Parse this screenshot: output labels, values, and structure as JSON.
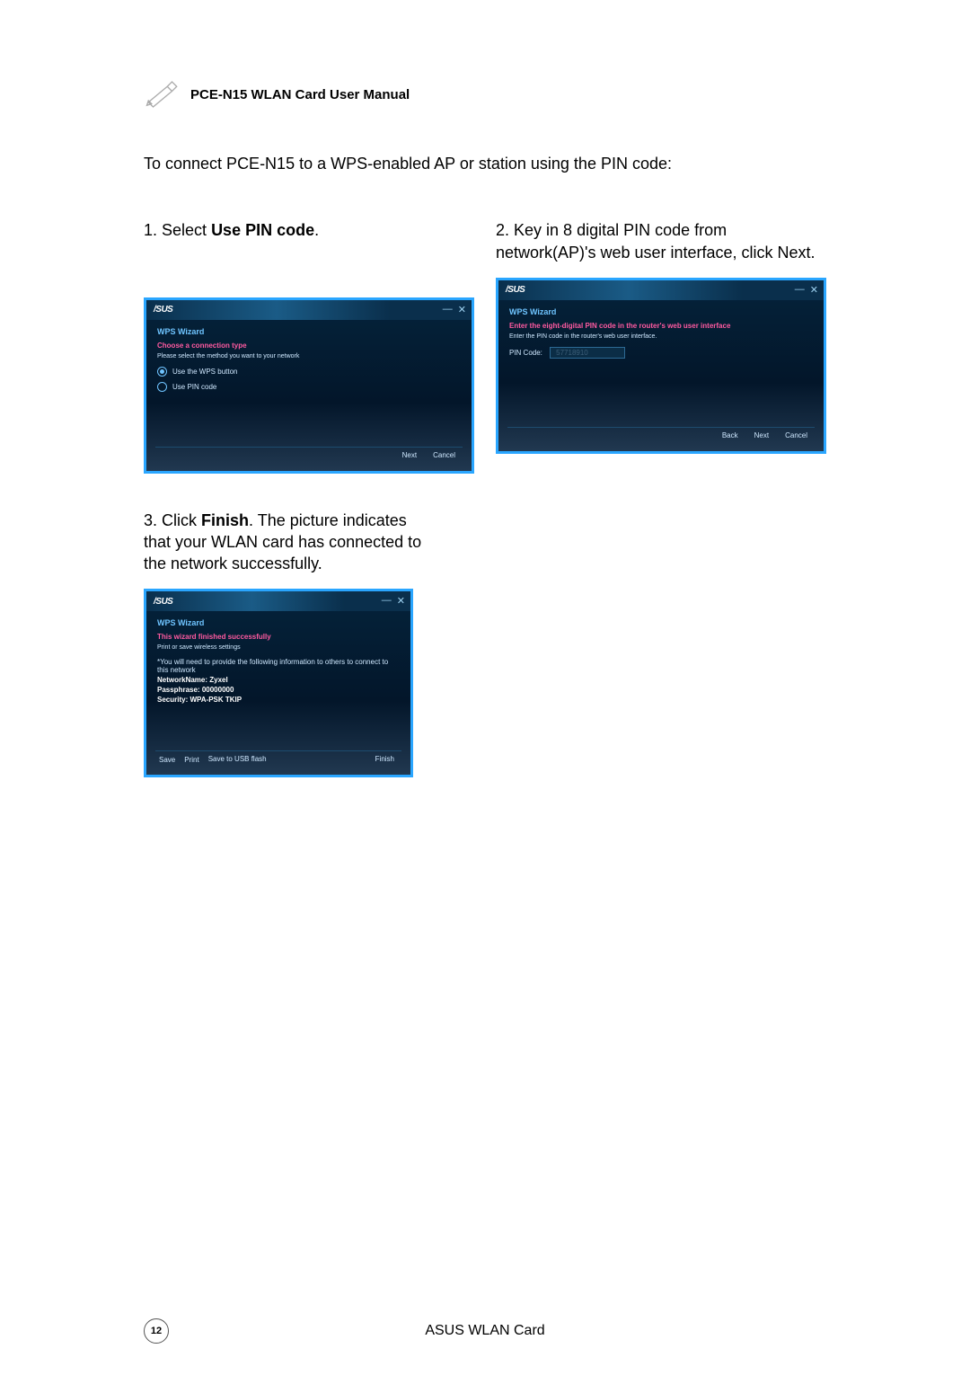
{
  "header": {
    "title": "PCE-N15 WLAN Card User Manual"
  },
  "intro": "To connect PCE-N15 to a WPS-enabled AP or station using the PIN code:",
  "step1": {
    "num": "1.",
    "pre": "Select ",
    "bold": "Use PIN code",
    "post": "."
  },
  "step2": {
    "num": "2.",
    "text": "Key in 8 digital PIN code from network(AP)'s web user interface, click Next."
  },
  "step3": {
    "num": "3.",
    "pre": "Click ",
    "bold": "Finish",
    "post": ". The picture indicates that your WLAN card has connected to the network successfully."
  },
  "dlg_common": {
    "logo": "/SUS",
    "wps": "WPS Wizard",
    "min": "—",
    "close": "✕"
  },
  "dlg1": {
    "title": "Choose a connection type",
    "hint": "Please select the method you want to your network",
    "opt1": "Use the WPS button",
    "opt2": "Use PIN code",
    "next": "Next",
    "cancel": "Cancel"
  },
  "dlg2": {
    "title": "Enter the eight-digital PIN code in the router's web user interface",
    "hint": "Enter the PIN code in the router's web user interface.",
    "pin_label": "PIN Code:",
    "pin_value": "57718910",
    "back": "Back",
    "next": "Next",
    "cancel": "Cancel"
  },
  "dlg3": {
    "title": "This wizard finished successfully",
    "hint": "Print or save wireless settings",
    "note": "*You will need to provide the following information to others to connect to this network",
    "net_label": "NetworkName:",
    "net_val": "Zyxel",
    "pass_label": "Passphrase:",
    "pass_val": "00000000",
    "sec_label": "Security:",
    "sec_val": "WPA-PSK TKIP",
    "save": "Save",
    "print": "Print",
    "usb": "Save to USB flash",
    "finish": "Finish"
  },
  "footer": {
    "page": "12",
    "text": "ASUS WLAN Card"
  }
}
